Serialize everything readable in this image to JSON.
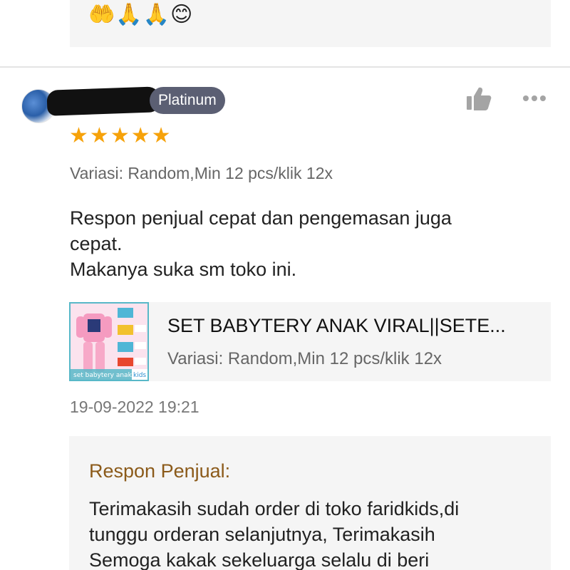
{
  "previous_review": {
    "emojis": "🤲🙏🙏😊"
  },
  "review": {
    "badge": "Platinum",
    "rating": 5,
    "stars": [
      "★",
      "★",
      "★",
      "★",
      "★"
    ],
    "variation": "Variasi: Random,Min 12 pcs/klik 12x",
    "comment_lines": [
      "Respon penjual cepat dan pengemasan juga",
      "cepat.",
      "Makanya suka sm toko ini."
    ],
    "product": {
      "title": "SET BABYTERY ANAK VIRAL||SETE...",
      "variation": "Variasi: Random,Min 12 pcs/klik 12x",
      "image_caption": "set babytery anak",
      "image_logo": "kids"
    },
    "timestamp": "19-09-2022 19:21"
  },
  "seller_reply": {
    "title": "Respon Penjual:",
    "lines": [
      "Terimakasih sudah order di toko faridkids,di",
      "tunggu orderan selanjutnya, Terimakasih",
      "Semoga kakak sekeluarga selalu di beri"
    ]
  },
  "icons": {
    "like": "thumbs-up-icon",
    "more": "more-dots-icon"
  },
  "colors": {
    "star": "#f6a20a",
    "badge_bg": "#5b5f73",
    "reply_title": "#8b5a1a",
    "card_bg": "#f5f5f5"
  }
}
